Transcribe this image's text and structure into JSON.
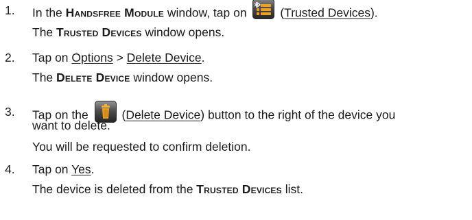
{
  "steps": [
    {
      "number": "1.",
      "line1": {
        "pre": "In the ",
        "window": "Handsfree Module",
        "mid": " window, tap on ",
        "icon": "trusted-devices-icon",
        "open_paren": " (",
        "link": "Trusted Devices",
        "close": ")."
      },
      "line2": {
        "window": "Trusted Devices",
        "post": " window opens.",
        "pre": "The "
      }
    },
    {
      "number": "2.",
      "line1": {
        "pre": "Tap on ",
        "link1": "Options",
        "sep": " > ",
        "link2": "Delete Device",
        "end": "."
      },
      "line2": {
        "pre": "The ",
        "window": "Delete Device",
        "post": " window opens."
      }
    },
    {
      "number": "3.",
      "line1": {
        "pre": "Tap on the ",
        "icon": "trash-can-icon",
        "open_paren": " (",
        "link": "Delete Device",
        "post": ") button to the right of the device you"
      },
      "line1b": "want to delete.",
      "line2": "You will be requested to confirm deletion."
    },
    {
      "number": "4.",
      "line1": {
        "pre": "Tap on ",
        "link": "Yes",
        "end": "."
      },
      "line2": {
        "pre": "The device is deleted from the ",
        "window": "Trusted Devices",
        "post": " list."
      }
    }
  ],
  "colors": {
    "text": "#1a1a1a",
    "icon_accent": "#f0a020"
  }
}
